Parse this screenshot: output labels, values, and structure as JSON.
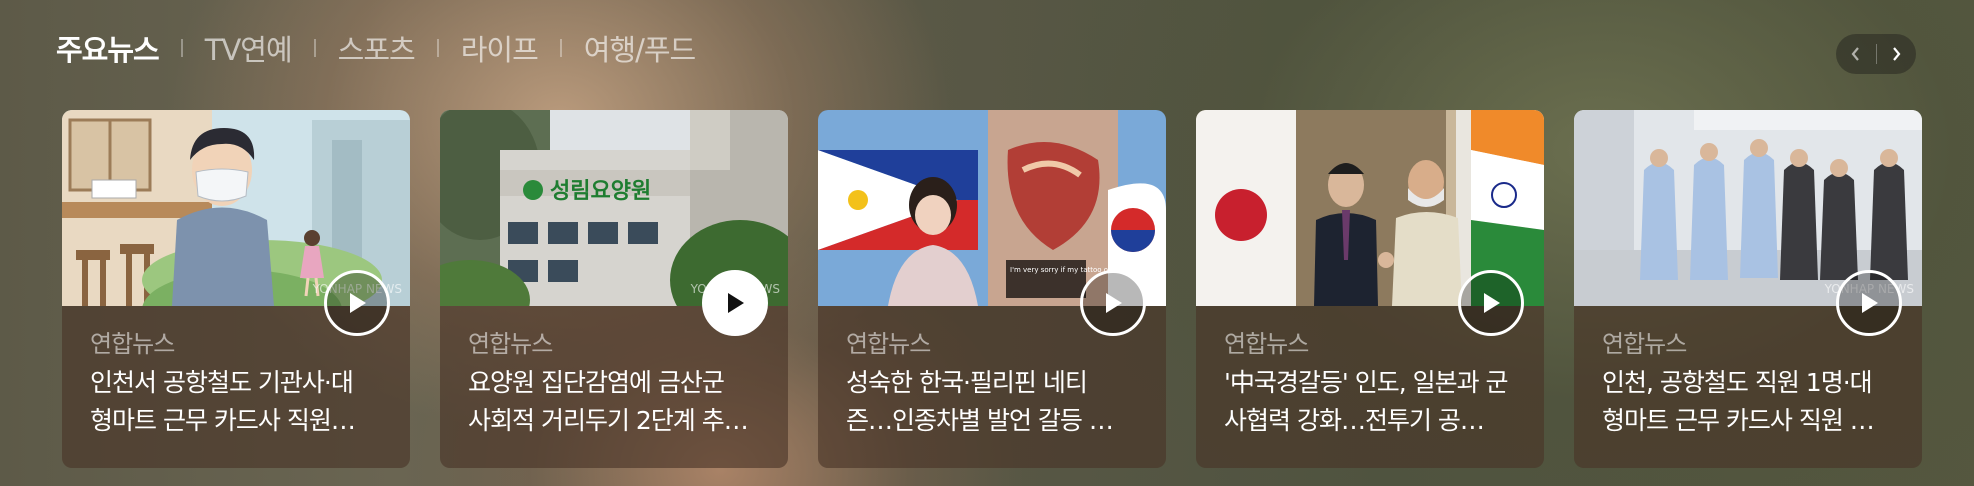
{
  "tabs": [
    {
      "label": "주요뉴스",
      "active": true
    },
    {
      "label": "TV연예",
      "active": false
    },
    {
      "label": "스포츠",
      "active": false
    },
    {
      "label": "라이프",
      "active": false
    },
    {
      "label": "여행/푸드",
      "active": false
    }
  ],
  "pager": {
    "prev_icon": "chevron-left-icon",
    "next_icon": "chevron-right-icon"
  },
  "cards": [
    {
      "source": "연합뉴스",
      "headline": "인천서 공항철도 기관사·대\n형마트 근무 카드사 직원…",
      "watermark": "YONHAP NEWS"
    },
    {
      "source": "연합뉴스",
      "headline": "요양원 집단감염에 금산군\n사회적 거리두기 2단계 추…",
      "sign": "성림요양원",
      "watermark": "YONHAP NEWS"
    },
    {
      "source": "연합뉴스",
      "headline": "성숙한 한국·필리핀 네티\n즌…인종차별 발언 갈등 …",
      "caption": "I'm very sorry if my tattoo offends you. I love Korea. Please forgive me"
    },
    {
      "source": "연합뉴스",
      "headline": "'中국경갈등' 인도, 일본과 군\n사협력 강화…전투기 공…"
    },
    {
      "source": "연합뉴스",
      "headline": "인천, 공항철도 직원 1명·대\n형마트 근무 카드사 직원 …",
      "watermark": "YONHAP NEWS"
    }
  ],
  "colors": {
    "active_tab": "#ffffff",
    "inactive_tab": "#c9c6bc",
    "card_bg": "#4a3526"
  }
}
